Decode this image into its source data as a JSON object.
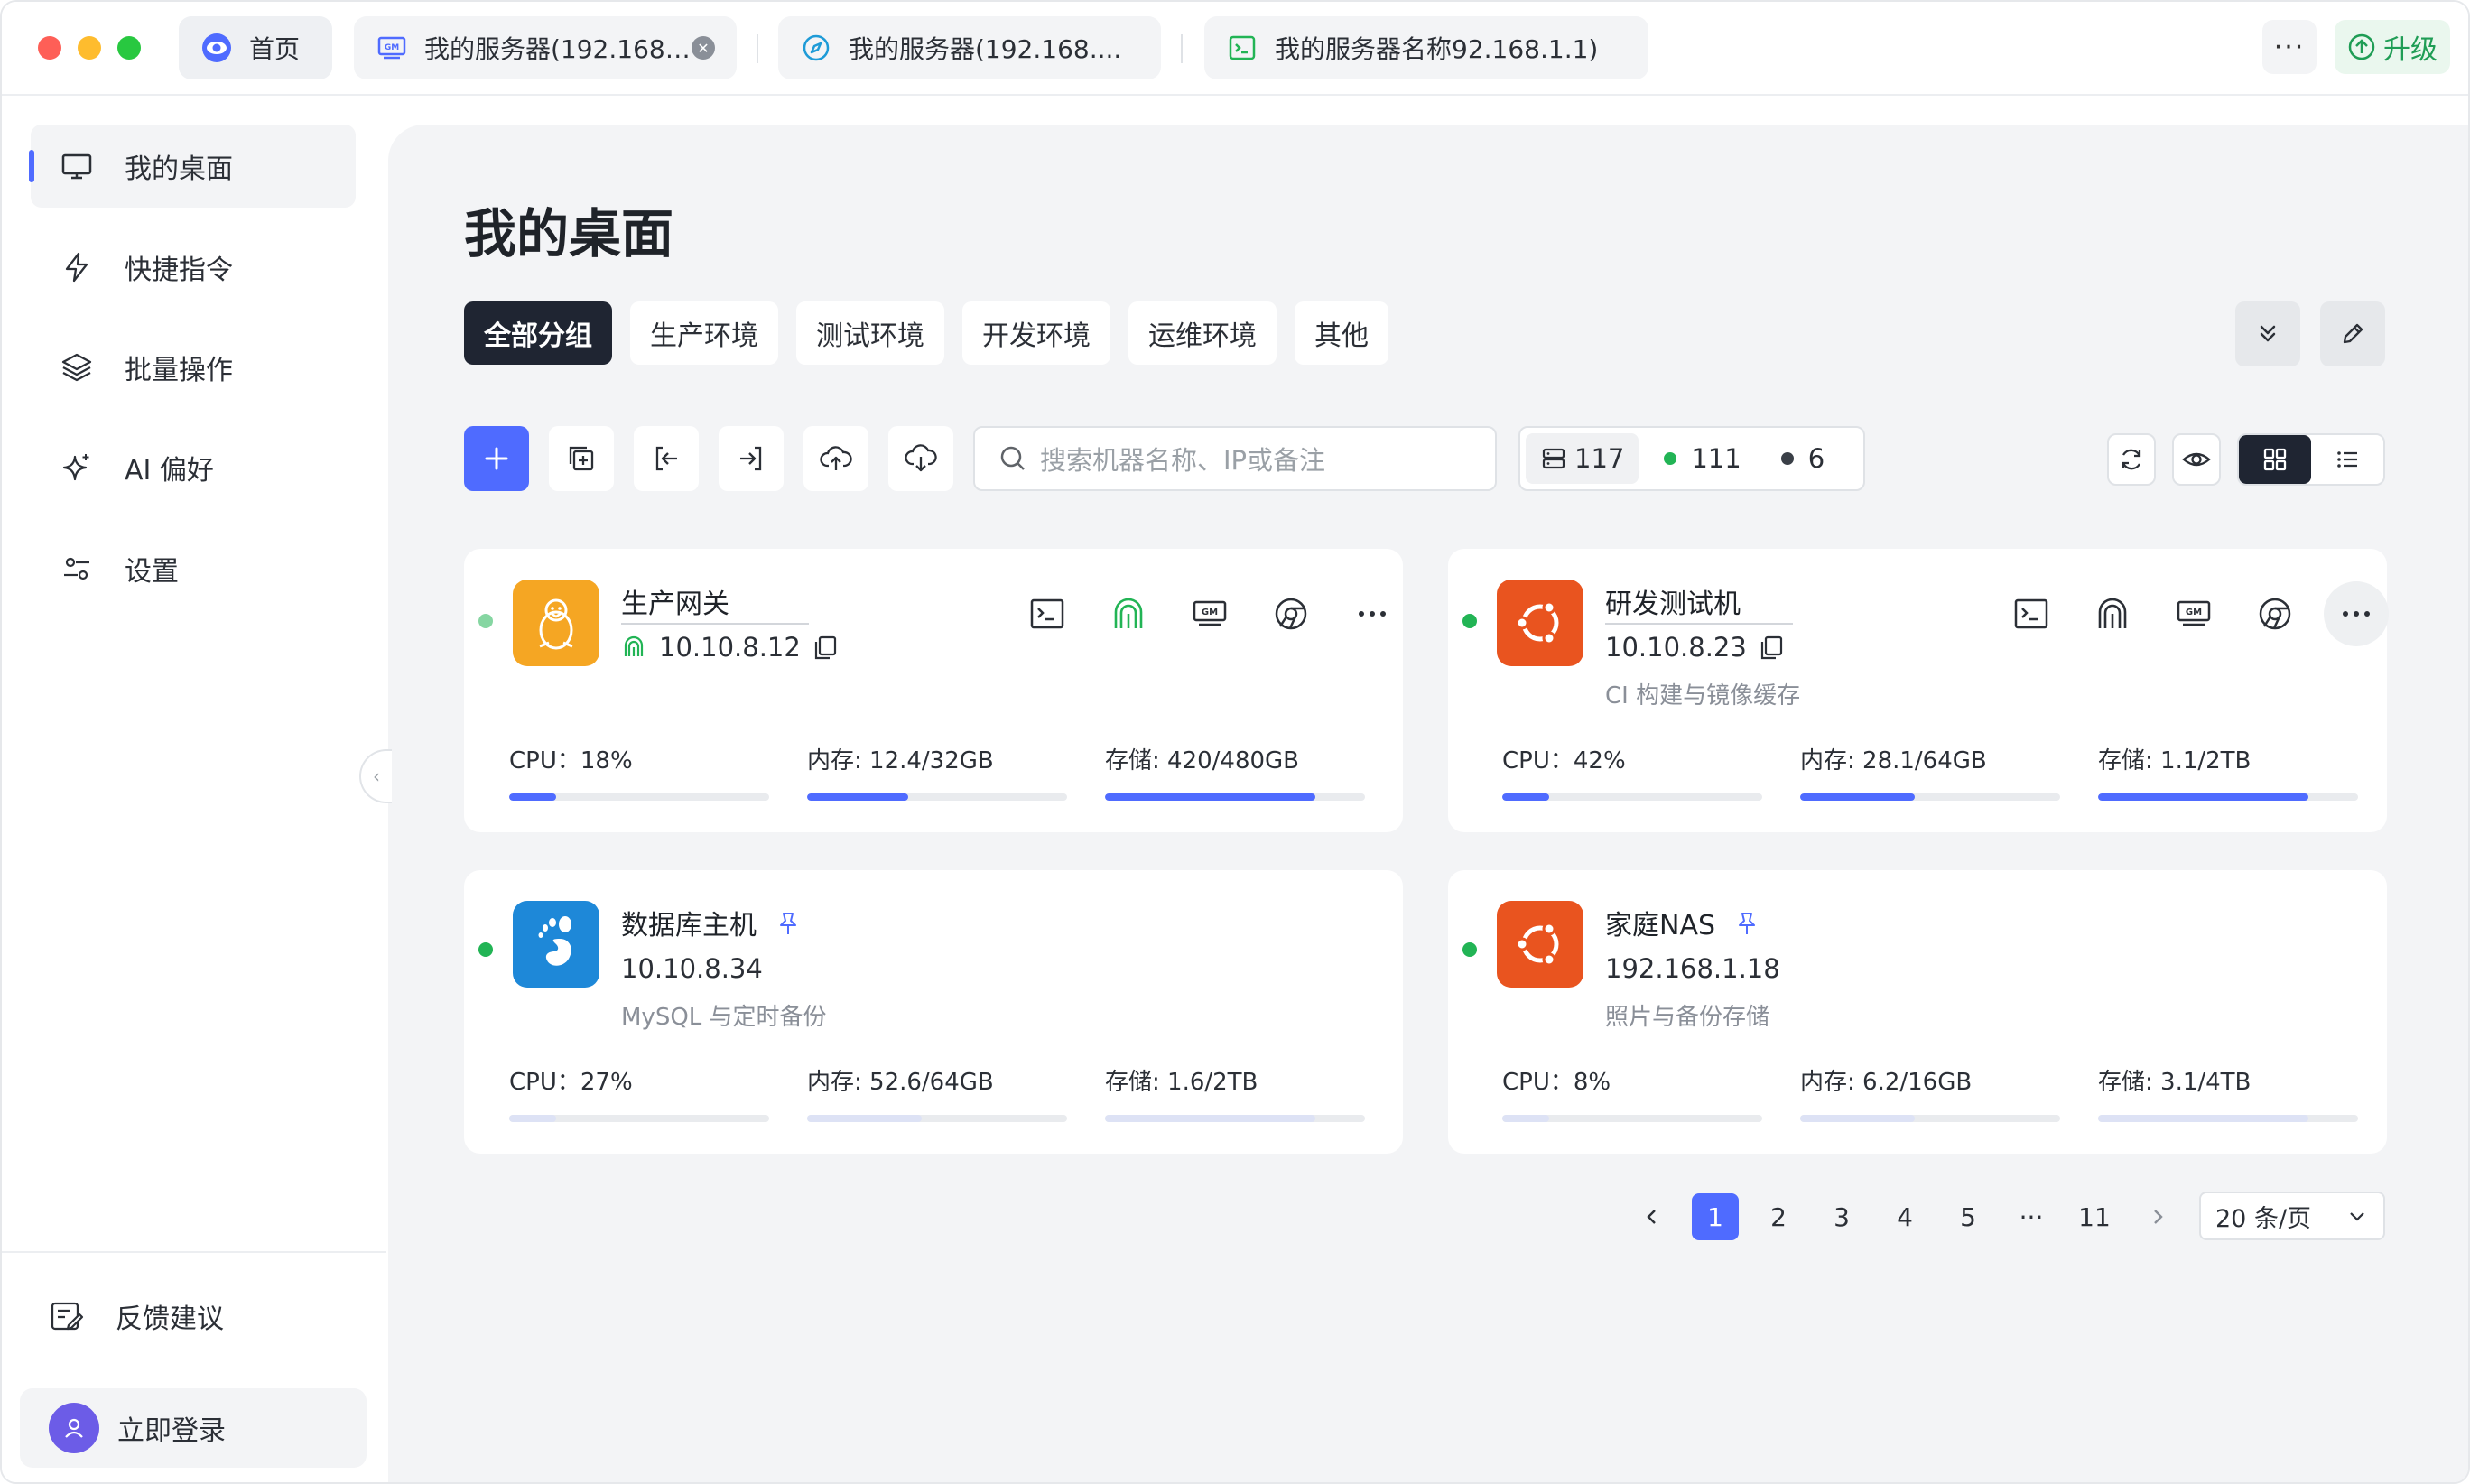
{
  "titlebar": {
    "tabs": [
      {
        "label": "首页",
        "icon": "eye-logo-icon"
      },
      {
        "label": "我的服务器(192.168....",
        "icon": "gm-icon"
      },
      {
        "label": "我的服务器(192.168....",
        "icon": "compass-icon"
      },
      {
        "label": "我的服务器名称92.168.1.1)",
        "icon": "terminal-icon"
      }
    ],
    "more_label": "···",
    "upgrade_label": "升级"
  },
  "sidebar": {
    "items": [
      {
        "label": "我的桌面",
        "icon": "monitor-icon",
        "active": true
      },
      {
        "label": "快捷指令",
        "icon": "lightning-icon"
      },
      {
        "label": "批量操作",
        "icon": "layers-icon"
      },
      {
        "label": "AI 偏好",
        "icon": "sparkle-icon"
      },
      {
        "label": "设置",
        "icon": "sliders-icon"
      }
    ],
    "feedback_label": "反馈建议",
    "login_label": "立即登录"
  },
  "main": {
    "title": "我的桌面",
    "group_tabs": [
      "全部分组",
      "生产环境",
      "测试环境",
      "开发环境",
      "运维环境",
      "其他"
    ],
    "search_placeholder": "搜索机器名称、IP或备注",
    "stats": {
      "total": "117",
      "online": "111",
      "offline": "6"
    },
    "colors": {
      "accent": "#4f6bff",
      "online": "#22b455",
      "offline": "#3a3f47",
      "dark": "#1f2532"
    }
  },
  "cards": [
    {
      "name": "生产网关",
      "ip": "10.10.8.12",
      "remark": "",
      "os": "linux",
      "pinned": false,
      "cpu_label": "CPU：18%",
      "mem_label": "内存: 12.4/32GB",
      "disk_label": "存储: 420/480GB",
      "cpu": 0.18,
      "mem": 0.39,
      "disk": 0.81
    },
    {
      "name": "研发测试机",
      "ip": "10.10.8.23",
      "remark": "CI 构建与镜像缓存",
      "os": "ubuntu",
      "pinned": false,
      "cpu_label": "CPU：42%",
      "mem_label": "内存: 28.1/64GB",
      "disk_label": "存储: 1.1/2TB",
      "cpu": 0.18,
      "mem": 0.44,
      "disk": 0.81
    },
    {
      "name": "数据库主机",
      "ip": "10.10.8.34",
      "remark": "MySQL 与定时备份",
      "os": "gnome",
      "pinned": true,
      "cpu_label": "CPU：27%",
      "mem_label": "内存: 52.6/64GB",
      "disk_label": "存储: 1.6/2TB",
      "cpu": 0.18,
      "mem": 0.44,
      "disk": 0.81
    },
    {
      "name": "家庭NAS",
      "ip": "192.168.1.18",
      "remark": "照片与备份存储",
      "os": "ubuntu",
      "pinned": true,
      "cpu_label": "CPU：8%",
      "mem_label": "内存: 6.2/16GB",
      "disk_label": "存储: 3.1/4TB",
      "cpu": 0.18,
      "mem": 0.44,
      "disk": 0.81
    }
  ],
  "pagination": {
    "pages": [
      "1",
      "2",
      "3",
      "4",
      "5",
      "···",
      "11"
    ],
    "current": "1",
    "page_size": "20 条/页"
  }
}
